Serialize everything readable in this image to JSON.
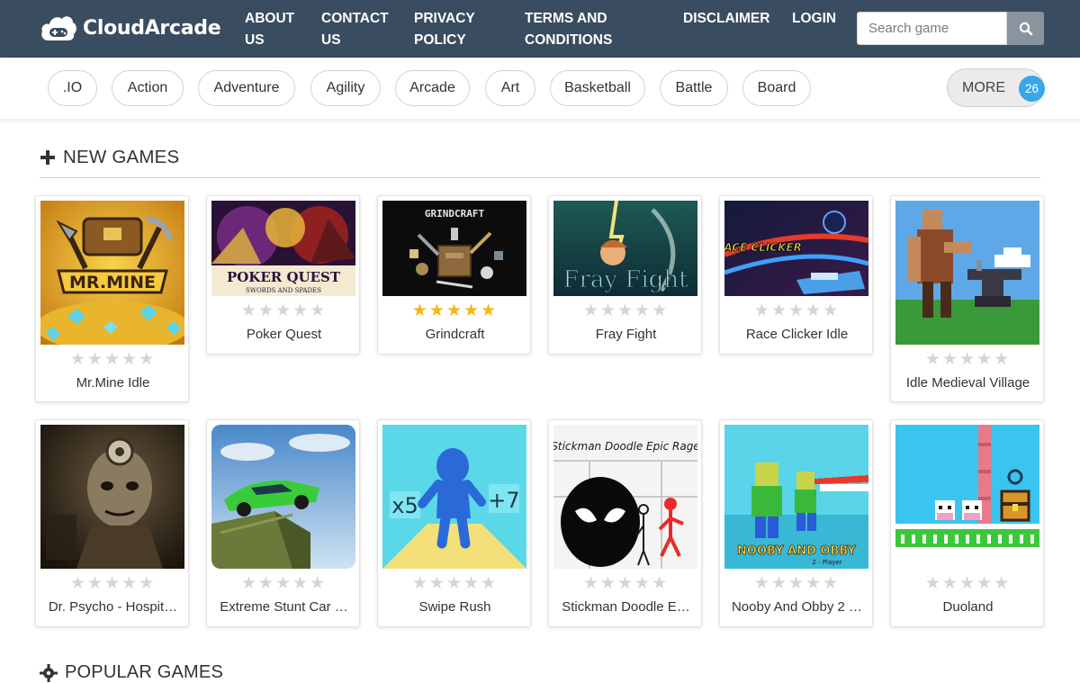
{
  "header": {
    "logo_text": "CloudArcade",
    "nav": [
      {
        "line1": "ABOUT",
        "line2": "US"
      },
      {
        "line1": "CONTACT",
        "line2": "US"
      },
      {
        "line1": "PRIVACY",
        "line2": "POLICY"
      },
      {
        "line1": "TERMS AND",
        "line2": "CONDITIONS"
      },
      {
        "line1": "DISCLAIMER",
        "line2": ""
      },
      {
        "line1": "LOGIN",
        "line2": ""
      }
    ],
    "search_placeholder": "Search game",
    "search_icon": "search-icon"
  },
  "categories": {
    "items": [
      ".IO",
      "Action",
      "Adventure",
      "Agility",
      "Arcade",
      "Art",
      "Basketball",
      "Battle",
      "Board"
    ],
    "more_label": "MORE",
    "more_count": "26"
  },
  "sections": {
    "new_games_title": "NEW GAMES",
    "popular_games_title": "POPULAR GAMES"
  },
  "games": [
    {
      "name": "Mr.Mine Idle",
      "rating": 0
    },
    {
      "name": "Poker Quest",
      "rating": 0
    },
    {
      "name": "Grindcraft",
      "rating": 5
    },
    {
      "name": "Fray Fight",
      "rating": 0
    },
    {
      "name": "Race Clicker Idle",
      "rating": 0
    },
    {
      "name": "Idle Medieval Village",
      "rating": 0
    },
    {
      "name": "Dr. Psycho - Hospit…",
      "rating": 0
    },
    {
      "name": "Extreme Stunt Car …",
      "rating": 0
    },
    {
      "name": "Swipe Rush",
      "rating": 0
    },
    {
      "name": "Stickman Doodle E…",
      "rating": 0
    },
    {
      "name": "Nooby And Obby 2 …",
      "rating": 0
    },
    {
      "name": "Duoland",
      "rating": 0
    }
  ],
  "thumb_text": {
    "mrmine": "MR.MINE",
    "poker": "POKER QUEST",
    "poker_sub": "SWORDS AND SPADES",
    "grindcraft": "GRINDCRAFT",
    "fray": "Fray Fight",
    "race": "RACE CLICKER",
    "swipe_left": "x5",
    "swipe_right": "+7",
    "stickman": "Stickman Doodle Epic Rage",
    "nooby": "NOOBY AND OBBY",
    "nooby_sub": "2 - Player"
  },
  "colors": {
    "header_bg": "#3a4c5f",
    "star_on": "#f2b90f",
    "star_off": "#d5d5d5",
    "badge": "#3aa6e6"
  }
}
